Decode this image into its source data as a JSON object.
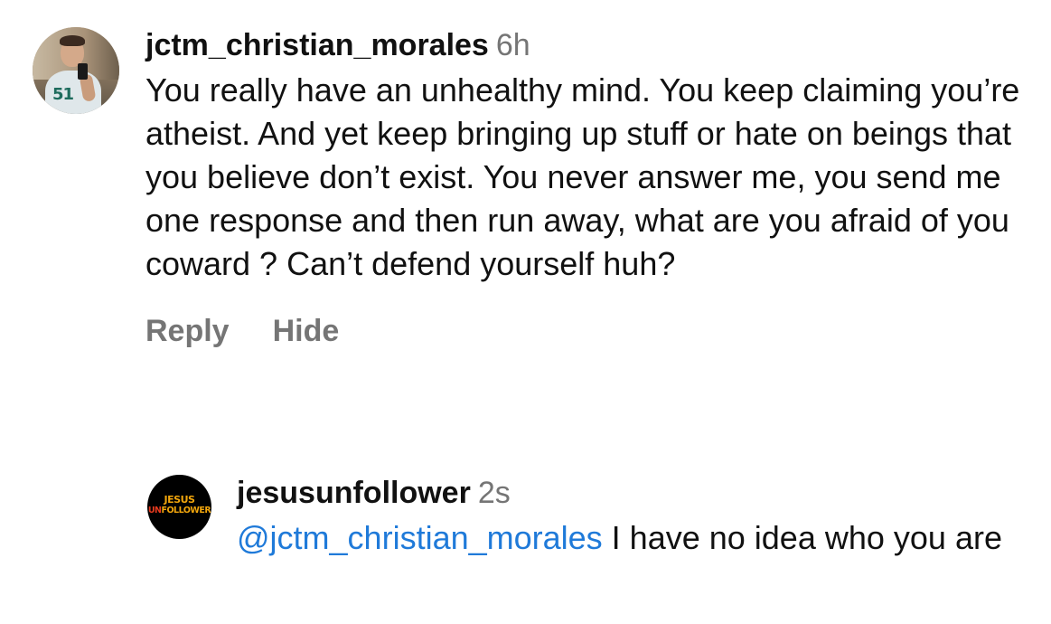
{
  "comments": [
    {
      "username": "jctm_christian_morales",
      "timestamp": "6h",
      "text": "You really have an unhealthy mind. You keep claiming you’re atheist. And yet keep bringing up stuff or hate on beings that you believe don’t exist. You never answer me, you send me one response and then run away, what are you afraid of you coward ? Can’t defend yourself huh?",
      "actions": {
        "reply": "Reply",
        "hide": "Hide"
      }
    },
    {
      "username": "jesusunfollower",
      "timestamp": "2s",
      "mention": "@jctm_christian_morales",
      "text": " I have no idea who you are",
      "avatar_logo": {
        "line1": "JESUS",
        "line2_prefix": "UN",
        "line2_suffix": "FOLLOWER"
      }
    }
  ],
  "colors": {
    "text": "#111111",
    "muted": "#757575",
    "mention": "#1f7ad9",
    "logo_orange": "#f2a60c",
    "logo_red": "#e83b1f"
  }
}
